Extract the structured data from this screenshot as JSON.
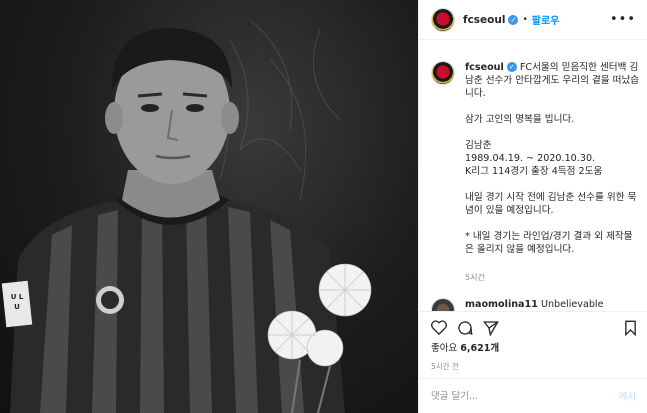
{
  "post": {
    "username": "fcseoul",
    "follow_label": "팔로우",
    "dot": "•",
    "more_label": "•••"
  },
  "caption": {
    "username": "fcseoul",
    "text": "FC서울의 믿음직한 센터백 김남춘 선수가 안타깝게도 우리의 곁을 떠났습니다.\n\n삼가 고인의 명복을 빕니다.\n\n김남춘\n1989.04.19. ~ 2020.10.30.\nK리그 114경기 출장 4득점 2도움\n\n내일 경기 시작 전에 김남춘 선수를 위한 묵념이 있을 예정입니다.\n\n* 내일 경기는 라인업/경기 결과 외 제작물은 올리지 않을 예정입니다.",
    "time": "5시간"
  },
  "reply": {
    "username": "maomolina11",
    "text": "Unbelievable"
  },
  "likes": {
    "prefix": "좋아요",
    "count": "6,621개"
  },
  "posted_ago": "5시간 전",
  "comment_box": {
    "placeholder": "댓글 달기...",
    "post_label": "게시"
  },
  "photo": {
    "jersey_text": "U L U"
  }
}
